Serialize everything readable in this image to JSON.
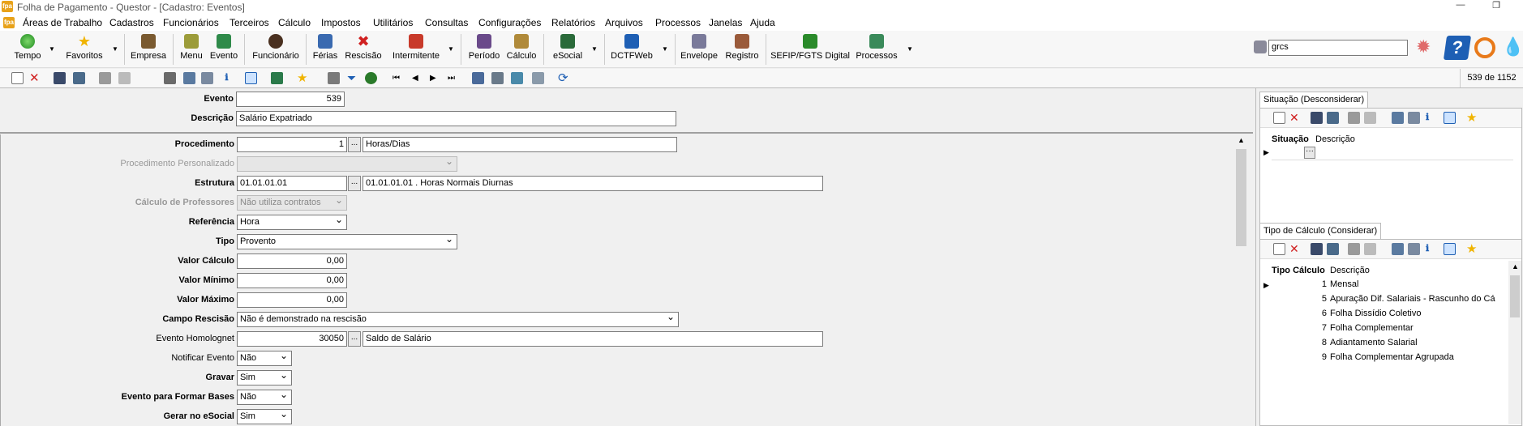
{
  "window": {
    "title": "Folha de Pagamento - Questor - [Cadastro: Eventos]",
    "app_icon_text": "fpa"
  },
  "menu": [
    "Áreas de Trabalho",
    "Cadastros",
    "Funcionários",
    "Terceiros",
    "Cálculo",
    "Impostos",
    "Utilitários",
    "Consultas",
    "Configurações",
    "Relatórios",
    "Arquivos",
    "Processos",
    "Janelas",
    "Ajuda"
  ],
  "toolbar": {
    "buttons": [
      "Tempo",
      "Favoritos",
      "Empresa",
      "Menu",
      "Evento",
      "Funcionário",
      "Férias",
      "Rescisão",
      "Intermitente",
      "Período",
      "Cálculo",
      "eSocial",
      "DCTFWeb",
      "Envelope",
      "Registro",
      "SEFIP/FGTS Digital",
      "Processos"
    ],
    "search_value": "grcs"
  },
  "record_counter": "539 de 1152",
  "form": {
    "evento": {
      "label": "Evento",
      "value": "539"
    },
    "descricao": {
      "label": "Descrição",
      "value": "Salário Expatriado"
    },
    "procedimento": {
      "label": "Procedimento",
      "code": "1",
      "desc": "Horas/Dias"
    },
    "procedimento_personalizado": {
      "label": "Procedimento Personalizado",
      "value": ""
    },
    "estrutura": {
      "label": "Estrutura",
      "code": "01.01.01.01",
      "desc": "01.01.01.01  .  Horas Normais Diurnas"
    },
    "calculo_professores": {
      "label": "Cálculo de Professores",
      "value": "Não utiliza contratos"
    },
    "referencia": {
      "label": "Referência",
      "value": "Hora"
    },
    "tipo": {
      "label": "Tipo",
      "value": "Provento"
    },
    "valor_calculo": {
      "label": "Valor Cálculo",
      "value": "0,00"
    },
    "valor_minimo": {
      "label": "Valor Mínimo",
      "value": "0,00"
    },
    "valor_maximo": {
      "label": "Valor Máximo",
      "value": "0,00"
    },
    "campo_rescisao": {
      "label": "Campo Rescisão",
      "value": "Não é demonstrado na rescisão"
    },
    "evento_homolognet": {
      "label": "Evento Homolognet",
      "code": "30050",
      "desc": "Saldo de Salário"
    },
    "notificar_evento": {
      "label": "Notificar Evento",
      "value": "Não"
    },
    "gravar": {
      "label": "Gravar",
      "value": "Sim"
    },
    "formar_bases": {
      "label": "Evento para Formar Bases",
      "value": "Não"
    },
    "gerar_esocial": {
      "label": "Gerar no eSocial",
      "value": "Sim"
    },
    "ellipsis": "..."
  },
  "situacao_panel": {
    "tab": "Situação (Desconsiderar)",
    "headers": [
      "Situação",
      "Descrição"
    ],
    "row_button": "···"
  },
  "tipo_calculo_panel": {
    "tab": "Tipo de Cálculo (Considerar)",
    "headers": [
      "Tipo Cálculo",
      "Descrição"
    ],
    "rows": [
      {
        "code": "1",
        "desc": "Mensal"
      },
      {
        "code": "5",
        "desc": "Apuração Dif. Salariais - Rascunho do Cá"
      },
      {
        "code": "6",
        "desc": "Folha Dissídio Coletivo"
      },
      {
        "code": "7",
        "desc": "Folha Complementar"
      },
      {
        "code": "8",
        "desc": "Adiantamento Salarial"
      },
      {
        "code": "9",
        "desc": "Folha Complementar Agrupada"
      }
    ]
  },
  "colors": {
    "accent": "#1e5fb4",
    "app_orange": "#e8a21a",
    "selection": "#000000"
  }
}
